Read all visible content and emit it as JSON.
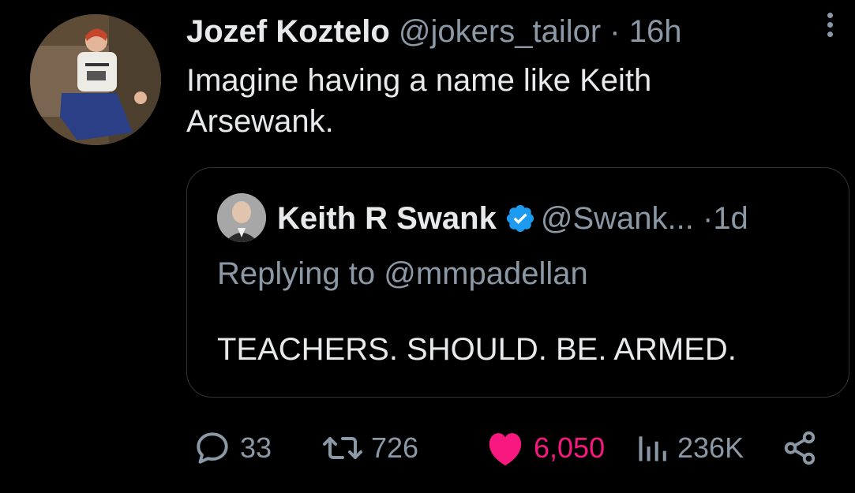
{
  "tweet": {
    "author_name": "Jozef Koztelo",
    "author_handle": "@jokers_tailor",
    "separator": "·",
    "time": "16h",
    "text": "Imagine having a name like Keith Arsewank."
  },
  "quoted_tweet": {
    "author_name": "Keith R Swank",
    "author_handle": "@Swank...",
    "separator": "·",
    "time": "1d",
    "replying_to": "Replying to @mmpadellan",
    "text": "TEACHERS. SHOULD. BE. ARMED."
  },
  "actions": {
    "replies": "33",
    "retweets": "726",
    "likes": "6,050",
    "views": "236K"
  },
  "icons": {
    "reply": "speech-bubble-icon",
    "retweet": "retweet-arrows-icon",
    "like": "heart-icon",
    "views": "bar-chart-icon",
    "share": "share-nodes-icon",
    "more": "vertical-ellipsis-icon",
    "verified": "verified-badge-icon"
  },
  "colors": {
    "background": "#000000",
    "primary_text": "#e7e9ea",
    "secondary_text": "#8b98a5",
    "like": "#f91880",
    "verified": "#1d9bf0",
    "quote_border": "#2f3336"
  }
}
